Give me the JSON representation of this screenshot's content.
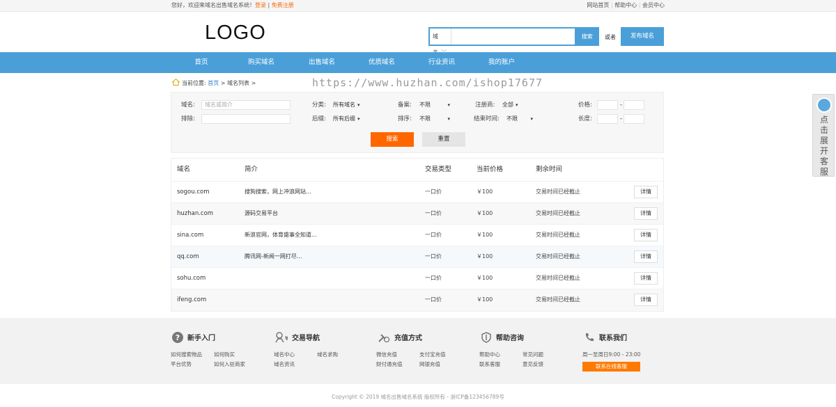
{
  "topbar": {
    "welcome": "您好，欢迎来域名出售域名系统！",
    "login": "登录",
    "sep": "|",
    "register": "免费注册",
    "links": [
      "网站首页",
      "帮助中心",
      "会员中心"
    ]
  },
  "header": {
    "logo": "LOGO",
    "search_select": "域名",
    "search_button": "搜索",
    "or_text": "或者",
    "publish_button": "发布域名"
  },
  "nav": [
    "首页",
    "购买域名",
    "出售域名",
    "优质域名",
    "行业资讯",
    "我的账户"
  ],
  "breadcrumb": {
    "prefix": "当前位置:",
    "home": "首页",
    "sep1": ">",
    "current": "域名列表",
    "sep2": ">"
  },
  "watermark": "https://www.huzhan.com/ishop17677",
  "filter": {
    "domain_label": "域名:",
    "domain_placeholder": "域名或简介",
    "exclude_label": "排除:",
    "category_label": "分类:",
    "category_value": "所有域名",
    "suffix_label": "后缀:",
    "suffix_value": "所有后缀",
    "icp_label": "备案:",
    "icp_value": "不限",
    "sort_label": "排序:",
    "sort_value": "不限",
    "registrar_label": "注册商:",
    "registrar_value": "全部",
    "end_label": "结束时间:",
    "end_value": "不限",
    "price_label": "价格:",
    "length_label": "长度:",
    "dash": "-",
    "search_button": "搜索",
    "reset_button": "重置"
  },
  "table": {
    "headers": [
      "域名",
      "简介",
      "交易类型",
      "当前价格",
      "剩余时间"
    ],
    "rows": [
      {
        "domain": "sogou.com",
        "intro": "搜狗搜索，网上冲浪网站...",
        "type": "一口价",
        "price": "￥100",
        "time": "交易时间已经截止",
        "action": "详情"
      },
      {
        "domain": "huzhan.com",
        "intro": "源码交易平台",
        "type": "一口价",
        "price": "￥100",
        "time": "交易时间已经截止",
        "action": "详情"
      },
      {
        "domain": "sina.com",
        "intro": "新浪官网，体育盛事全知道...",
        "type": "一口价",
        "price": "￥100",
        "time": "交易时间已经截止",
        "action": "详情"
      },
      {
        "domain": "qq.com",
        "intro": "腾讯网-新闻一网打尽...",
        "type": "一口价",
        "price": "￥100",
        "time": "交易时间已经截止",
        "action": "详情"
      },
      {
        "domain": "sohu.com",
        "intro": "",
        "type": "一口价",
        "price": "￥100",
        "time": "交易时间已经截止",
        "action": "详情"
      },
      {
        "domain": "ifeng.com",
        "intro": "",
        "type": "一口价",
        "price": "￥100",
        "time": "交易时间已经截止",
        "action": "详情"
      }
    ]
  },
  "footer": {
    "cols": [
      {
        "title": "新手入门",
        "icon": "question-icon",
        "links": [
          [
            "如何搜索物品",
            "如何购买"
          ],
          [
            "平台优势",
            "如何入驻商家"
          ]
        ]
      },
      {
        "title": "交易导航",
        "icon": "trade-icon",
        "links": [
          [
            "域名中心",
            "域名求购"
          ],
          [
            "域名资讯",
            ""
          ]
        ]
      },
      {
        "title": "充值方式",
        "icon": "recharge-icon",
        "links": [
          [
            "微信充值",
            "支付宝充值"
          ],
          [
            "财付通充值",
            "网银充值"
          ]
        ]
      },
      {
        "title": "帮助咨询",
        "icon": "shield-icon",
        "links": [
          [
            "帮助中心",
            "常见问题"
          ],
          [
            "联系客服",
            "意见反馈"
          ]
        ]
      },
      {
        "title": "联系我们",
        "icon": "phone-icon",
        "hours": "周一至周日9:00 - 23:00",
        "button": "联系在线客服"
      }
    ],
    "copyright": "Copyright © 2019 域名出售域名系统 版权所有 - 浙ICP备123456789号"
  },
  "side_service": {
    "text": "点击展开客服"
  },
  "colors": {
    "primary": "#4b9fd8",
    "accent": "#ff6600"
  }
}
